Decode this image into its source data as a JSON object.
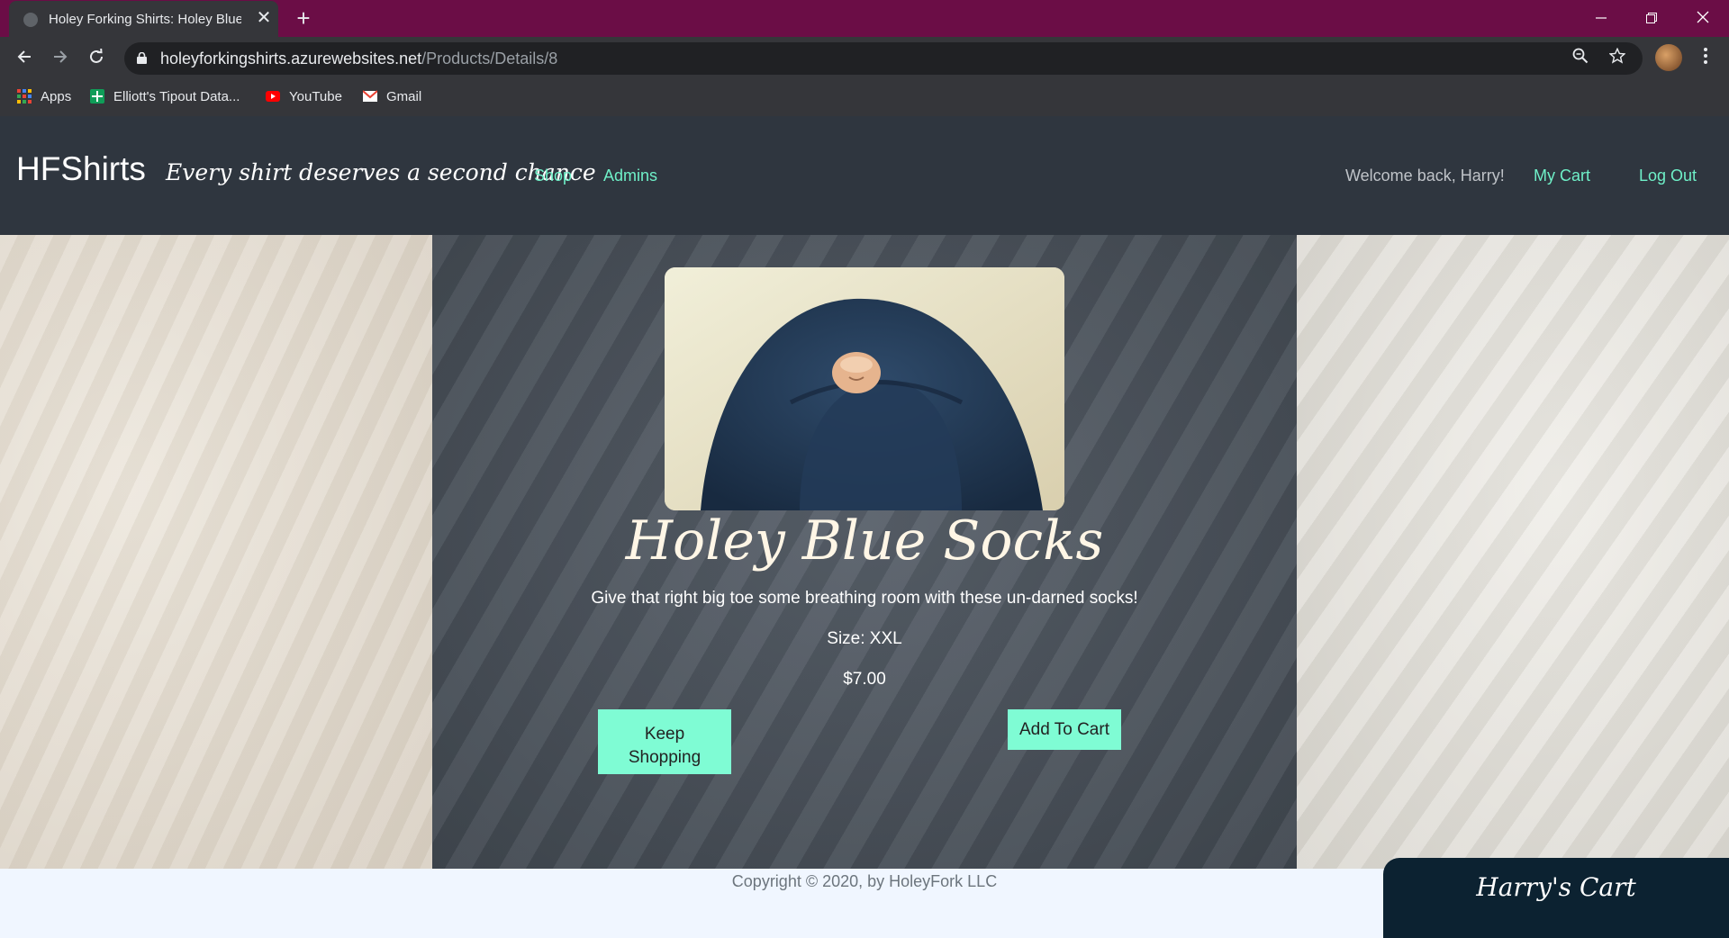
{
  "browser": {
    "tab_title": "Holey Forking Shirts: Holey Blue Socks",
    "new_tab_symbol": "+",
    "close_symbol": "✕",
    "url_host": "holeyforkingshirts.azurewebsites.net",
    "url_path": "/Products/Details/8",
    "bookmarks": [
      "Apps",
      "Elliott's Tipout Data...",
      "YouTube",
      "Gmail"
    ],
    "icons": [
      "back-icon",
      "forward-icon",
      "reload-icon",
      "lock-icon",
      "zoom-icon",
      "star-icon",
      "profile-avatar",
      "menu-icon"
    ]
  },
  "header": {
    "brand": "HFShirts",
    "tagline": "Every shirt deserves a second chance",
    "nav": {
      "shop": "Shop",
      "admins": "Admins"
    },
    "welcome": "Welcome back, Harry!",
    "my_cart": "My Cart",
    "log_out": "Log Out"
  },
  "product": {
    "title": "Holey Blue Socks",
    "description": "Give that right big toe some breathing room with these un-darned socks!",
    "size": "Size: XXL",
    "price": "$7.00",
    "keep_shopping_line1": "Keep",
    "keep_shopping_line2": "Shopping",
    "add_to_cart": "Add To Cart"
  },
  "footer": {
    "copyright": "Copyright © 2020, by HoleyFork LLC",
    "cart_tab": "Harry's Cart"
  },
  "colors": {
    "tab_bar": "#6b0d46",
    "header_bg": "#2f363f",
    "link": "#6ff0c8",
    "button": "#7ffcd4",
    "cart_tab": "#0c2231"
  }
}
